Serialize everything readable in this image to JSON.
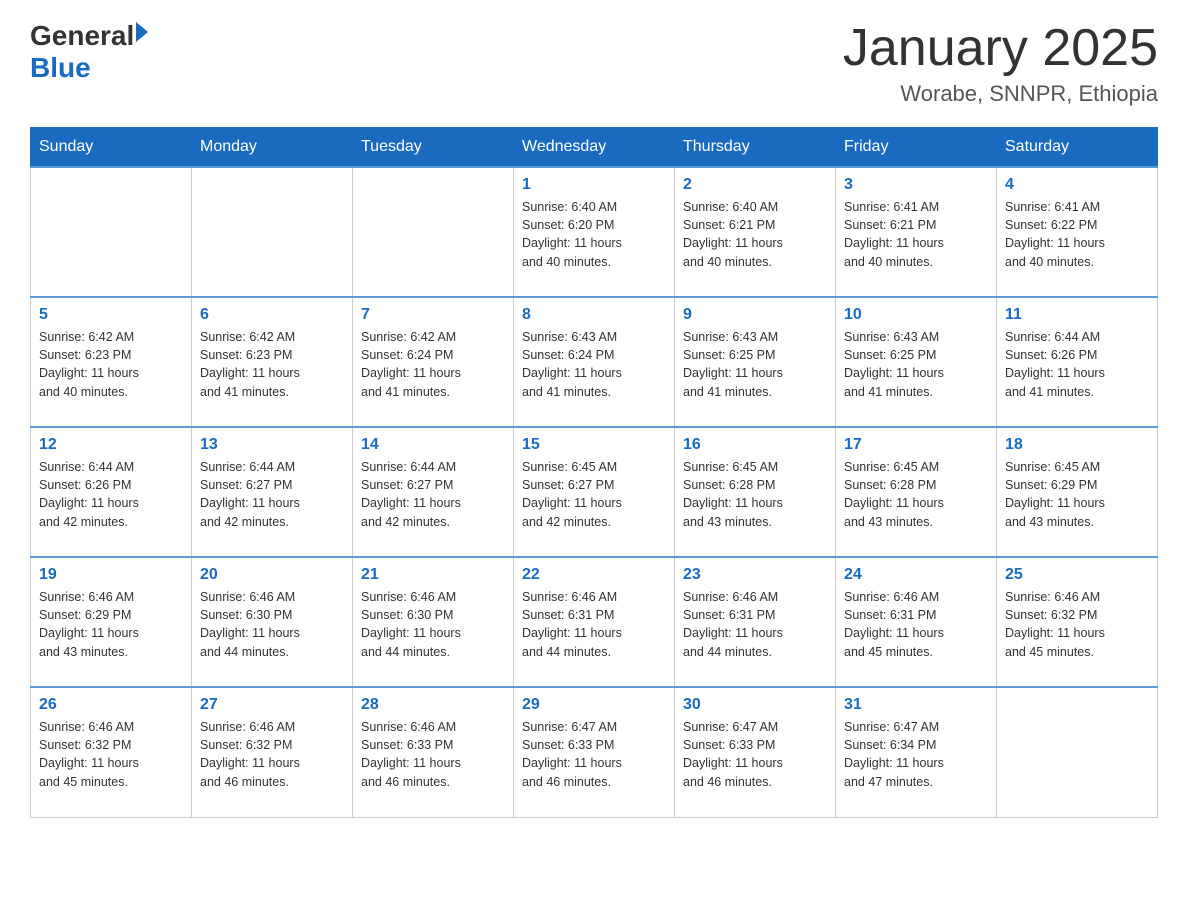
{
  "header": {
    "logo_general": "General",
    "logo_blue": "Blue",
    "month_title": "January 2025",
    "subtitle": "Worabe, SNNPR, Ethiopia"
  },
  "days_of_week": [
    "Sunday",
    "Monday",
    "Tuesday",
    "Wednesday",
    "Thursday",
    "Friday",
    "Saturday"
  ],
  "weeks": [
    [
      {
        "day": "",
        "info": ""
      },
      {
        "day": "",
        "info": ""
      },
      {
        "day": "",
        "info": ""
      },
      {
        "day": "1",
        "info": "Sunrise: 6:40 AM\nSunset: 6:20 PM\nDaylight: 11 hours\nand 40 minutes."
      },
      {
        "day": "2",
        "info": "Sunrise: 6:40 AM\nSunset: 6:21 PM\nDaylight: 11 hours\nand 40 minutes."
      },
      {
        "day": "3",
        "info": "Sunrise: 6:41 AM\nSunset: 6:21 PM\nDaylight: 11 hours\nand 40 minutes."
      },
      {
        "day": "4",
        "info": "Sunrise: 6:41 AM\nSunset: 6:22 PM\nDaylight: 11 hours\nand 40 minutes."
      }
    ],
    [
      {
        "day": "5",
        "info": "Sunrise: 6:42 AM\nSunset: 6:23 PM\nDaylight: 11 hours\nand 40 minutes."
      },
      {
        "day": "6",
        "info": "Sunrise: 6:42 AM\nSunset: 6:23 PM\nDaylight: 11 hours\nand 41 minutes."
      },
      {
        "day": "7",
        "info": "Sunrise: 6:42 AM\nSunset: 6:24 PM\nDaylight: 11 hours\nand 41 minutes."
      },
      {
        "day": "8",
        "info": "Sunrise: 6:43 AM\nSunset: 6:24 PM\nDaylight: 11 hours\nand 41 minutes."
      },
      {
        "day": "9",
        "info": "Sunrise: 6:43 AM\nSunset: 6:25 PM\nDaylight: 11 hours\nand 41 minutes."
      },
      {
        "day": "10",
        "info": "Sunrise: 6:43 AM\nSunset: 6:25 PM\nDaylight: 11 hours\nand 41 minutes."
      },
      {
        "day": "11",
        "info": "Sunrise: 6:44 AM\nSunset: 6:26 PM\nDaylight: 11 hours\nand 41 minutes."
      }
    ],
    [
      {
        "day": "12",
        "info": "Sunrise: 6:44 AM\nSunset: 6:26 PM\nDaylight: 11 hours\nand 42 minutes."
      },
      {
        "day": "13",
        "info": "Sunrise: 6:44 AM\nSunset: 6:27 PM\nDaylight: 11 hours\nand 42 minutes."
      },
      {
        "day": "14",
        "info": "Sunrise: 6:44 AM\nSunset: 6:27 PM\nDaylight: 11 hours\nand 42 minutes."
      },
      {
        "day": "15",
        "info": "Sunrise: 6:45 AM\nSunset: 6:27 PM\nDaylight: 11 hours\nand 42 minutes."
      },
      {
        "day": "16",
        "info": "Sunrise: 6:45 AM\nSunset: 6:28 PM\nDaylight: 11 hours\nand 43 minutes."
      },
      {
        "day": "17",
        "info": "Sunrise: 6:45 AM\nSunset: 6:28 PM\nDaylight: 11 hours\nand 43 minutes."
      },
      {
        "day": "18",
        "info": "Sunrise: 6:45 AM\nSunset: 6:29 PM\nDaylight: 11 hours\nand 43 minutes."
      }
    ],
    [
      {
        "day": "19",
        "info": "Sunrise: 6:46 AM\nSunset: 6:29 PM\nDaylight: 11 hours\nand 43 minutes."
      },
      {
        "day": "20",
        "info": "Sunrise: 6:46 AM\nSunset: 6:30 PM\nDaylight: 11 hours\nand 44 minutes."
      },
      {
        "day": "21",
        "info": "Sunrise: 6:46 AM\nSunset: 6:30 PM\nDaylight: 11 hours\nand 44 minutes."
      },
      {
        "day": "22",
        "info": "Sunrise: 6:46 AM\nSunset: 6:31 PM\nDaylight: 11 hours\nand 44 minutes."
      },
      {
        "day": "23",
        "info": "Sunrise: 6:46 AM\nSunset: 6:31 PM\nDaylight: 11 hours\nand 44 minutes."
      },
      {
        "day": "24",
        "info": "Sunrise: 6:46 AM\nSunset: 6:31 PM\nDaylight: 11 hours\nand 45 minutes."
      },
      {
        "day": "25",
        "info": "Sunrise: 6:46 AM\nSunset: 6:32 PM\nDaylight: 11 hours\nand 45 minutes."
      }
    ],
    [
      {
        "day": "26",
        "info": "Sunrise: 6:46 AM\nSunset: 6:32 PM\nDaylight: 11 hours\nand 45 minutes."
      },
      {
        "day": "27",
        "info": "Sunrise: 6:46 AM\nSunset: 6:32 PM\nDaylight: 11 hours\nand 46 minutes."
      },
      {
        "day": "28",
        "info": "Sunrise: 6:46 AM\nSunset: 6:33 PM\nDaylight: 11 hours\nand 46 minutes."
      },
      {
        "day": "29",
        "info": "Sunrise: 6:47 AM\nSunset: 6:33 PM\nDaylight: 11 hours\nand 46 minutes."
      },
      {
        "day": "30",
        "info": "Sunrise: 6:47 AM\nSunset: 6:33 PM\nDaylight: 11 hours\nand 46 minutes."
      },
      {
        "day": "31",
        "info": "Sunrise: 6:47 AM\nSunset: 6:34 PM\nDaylight: 11 hours\nand 47 minutes."
      },
      {
        "day": "",
        "info": ""
      }
    ]
  ]
}
